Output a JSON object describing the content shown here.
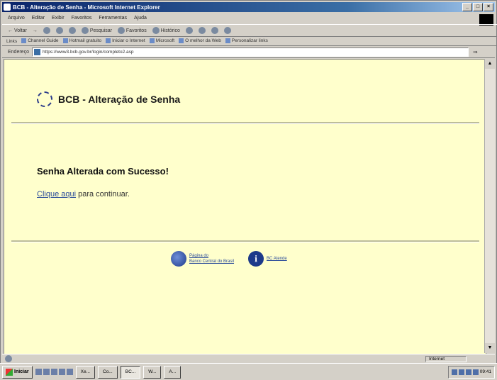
{
  "window": {
    "title": "BCB - Alteração de Senha - Microsoft Internet Explorer",
    "controls": [
      "_",
      "□",
      "×"
    ]
  },
  "menu": [
    "Arquivo",
    "Editar",
    "Exibir",
    "Favoritos",
    "Ferramentas",
    "Ajuda"
  ],
  "toolbar": {
    "back": "Voltar",
    "search": "Pesquisar",
    "favorites": "Favoritos",
    "history": "Histórico"
  },
  "links_bar": {
    "label": "Links",
    "items": [
      "Channel Guide",
      "Hotmail gratuito",
      "Iniciar o Internet",
      "Microsoft",
      "O melhor da Web",
      "Personalizar links"
    ]
  },
  "address": {
    "label": "Endereço",
    "url": "https://www3.bcb.gov.br/login/completo2.asp",
    "go_icon": "arrow-right"
  },
  "page": {
    "title": "BCB - Alteração de Senha",
    "message": "Senha Alterada com Sucesso!",
    "continue_link": "Clique aqui",
    "continue_text": " para continuar.",
    "footer": {
      "home_link_line1": "Página do",
      "home_link_line2": "Banco Central do Brasil",
      "help_link": "BC Atende"
    }
  },
  "status": {
    "left_icon": "ie-page-icon",
    "zone": "Internet"
  },
  "taskbar": {
    "start": "Iniciar",
    "tasks": [
      "Xe...",
      "Co...",
      "BC...",
      "W...",
      "A..."
    ],
    "active_task_index": 2,
    "clock": "09:41"
  },
  "colors": {
    "page_background": "#ffffcc",
    "link": "#2b4c9a",
    "title_bar": "#0a246a"
  }
}
